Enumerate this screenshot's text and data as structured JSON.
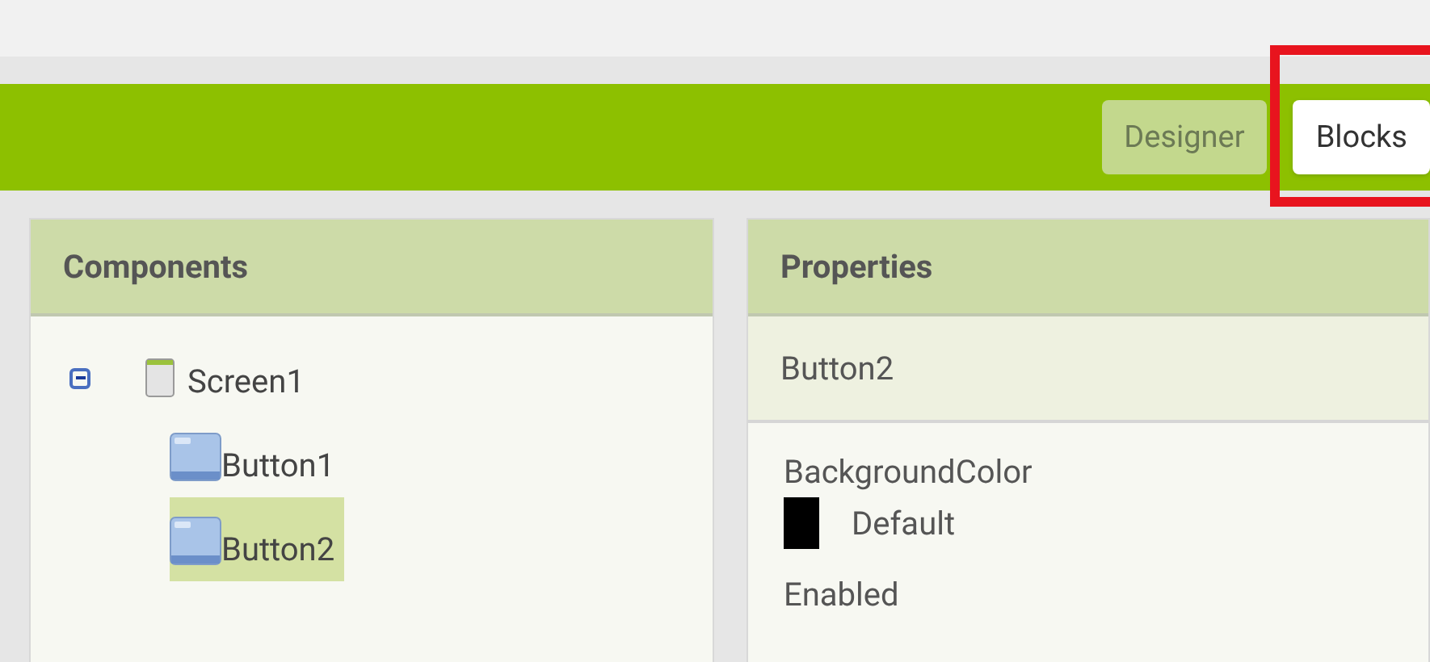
{
  "tabs": [
    {
      "label": "Designer",
      "selected": true,
      "highlighted": false
    },
    {
      "label": "Blocks",
      "selected": false,
      "highlighted": true
    }
  ],
  "components": {
    "title": "Components",
    "tree": [
      {
        "label": "Screen1",
        "kind": "screen",
        "expanded": true,
        "selected": false,
        "children": [
          {
            "label": "Button1",
            "kind": "button",
            "selected": false
          },
          {
            "label": "Button2",
            "kind": "button",
            "selected": true
          }
        ]
      }
    ]
  },
  "properties": {
    "title": "Properties",
    "component": "Button2",
    "items": [
      {
        "name": "BackgroundColor",
        "kind": "color",
        "color": "#000000",
        "value": "Default"
      },
      {
        "name": "Enabled",
        "kind": "plain"
      }
    ]
  }
}
